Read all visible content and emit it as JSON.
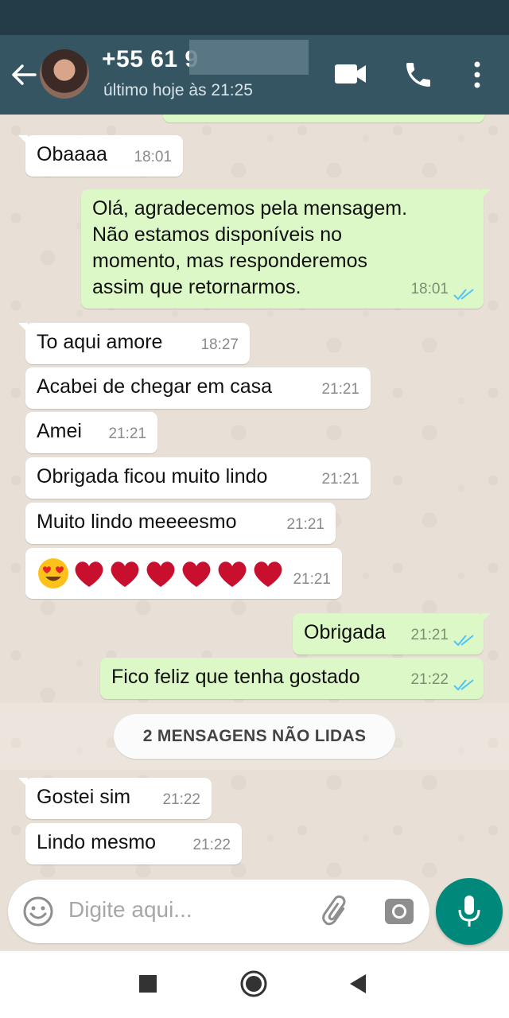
{
  "header": {
    "contact_name": "+55 61 9",
    "last_seen": "último hoje às 21:25",
    "colors": {
      "bar": "#365563",
      "status": "#243c47"
    }
  },
  "messages": [
    {
      "dir": "in",
      "text": "Obaaaa",
      "time": "18:01"
    },
    {
      "dir": "out",
      "text": "Olá, agradecemos pela mensagem.\nNão estamos disponíveis no\nmomento, mas responderemos\nassim que retornarmos.",
      "time": "18:01",
      "status": "read"
    },
    {
      "dir": "in",
      "text": "To aqui amore",
      "time": "18:27"
    },
    {
      "dir": "in",
      "text": "Acabei de chegar em casa",
      "time": "21:21"
    },
    {
      "dir": "in",
      "text": "Amei",
      "time": "21:21"
    },
    {
      "dir": "in",
      "text": "Obrigada ficou muito lindo",
      "time": "21:21"
    },
    {
      "dir": "in",
      "text": "Muito lindo meeeesmo",
      "time": "21:21"
    },
    {
      "dir": "in",
      "emoji": [
        "heart-eyes-emoji",
        "heart",
        "heart",
        "heart",
        "heart",
        "heart",
        "heart"
      ],
      "time": "21:21"
    },
    {
      "dir": "out",
      "text": "Obrigada",
      "time": "21:21",
      "status": "read"
    },
    {
      "dir": "out",
      "text": "Fico feliz que tenha gostado",
      "time": "21:22",
      "status": "read"
    },
    {
      "dir": "in",
      "text": "Gostei sim",
      "time": "21:22"
    },
    {
      "dir": "in",
      "text": "Lindo mesmo",
      "time": "21:22"
    }
  ],
  "unread_banner": "2 MENSAGENS NÃO LIDAS",
  "composer": {
    "placeholder": "Digite aqui...",
    "icons": [
      "emoji-icon",
      "paperclip-icon",
      "camera-icon",
      "mic-icon"
    ]
  },
  "nav": {
    "icons": [
      "recents-icon",
      "home-icon",
      "back-icon"
    ]
  },
  "colors": {
    "incoming": "#ffffff",
    "outgoing": "#dcf8c6",
    "accent": "#00897b",
    "read_ticks": "#4fc3f7"
  }
}
